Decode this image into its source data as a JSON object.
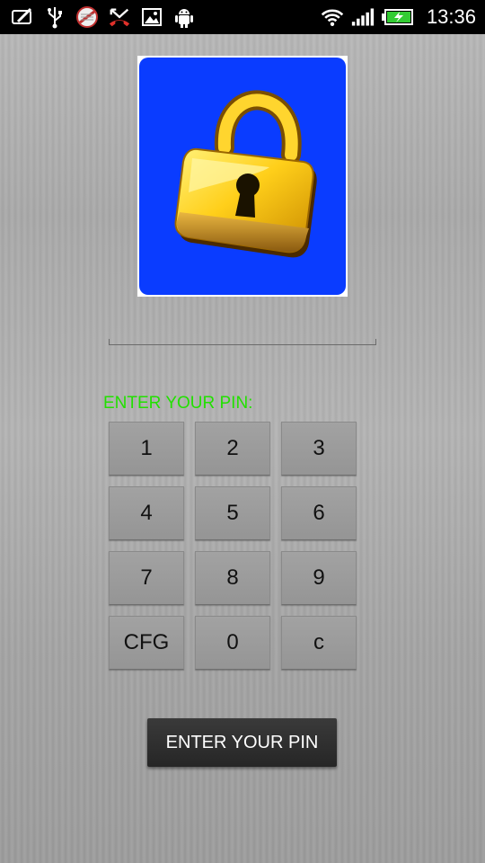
{
  "status_bar": {
    "time": "13:36",
    "icons": [
      "screen-edit-icon",
      "usb-icon",
      "no-sign-icon",
      "missed-call-icon",
      "image-icon",
      "android-debug-icon",
      "wifi-icon",
      "signal-icon",
      "battery-charging-icon"
    ]
  },
  "lock_image": {
    "icon": "padlock-icon",
    "background": "#0a3cff"
  },
  "pin_field": {
    "value": ""
  },
  "prompt": {
    "text": "ENTER YOUR PIN:",
    "color": "#22e000"
  },
  "keypad": {
    "keys": [
      "1",
      "2",
      "3",
      "4",
      "5",
      "6",
      "7",
      "8",
      "9",
      "CFG",
      "0",
      "c"
    ]
  },
  "submit_button": {
    "label": "ENTER YOUR PIN"
  }
}
